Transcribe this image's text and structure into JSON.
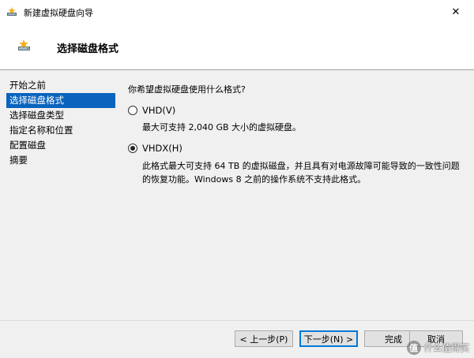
{
  "window": {
    "title": "新建虚拟硬盘向导",
    "close_glyph": "✕"
  },
  "header": {
    "title": "选择磁盘格式"
  },
  "sidebar": {
    "items": [
      {
        "label": "开始之前",
        "active": false
      },
      {
        "label": "选择磁盘格式",
        "active": true
      },
      {
        "label": "选择磁盘类型",
        "active": false
      },
      {
        "label": "指定名称和位置",
        "active": false
      },
      {
        "label": "配置磁盘",
        "active": false
      },
      {
        "label": "摘要",
        "active": false
      }
    ]
  },
  "main": {
    "question": "你希望虚拟硬盘使用什么格式?",
    "options": [
      {
        "label": "VHD(V)",
        "checked": false,
        "description": "最大可支持 2,040 GB 大小的虚拟硬盘。"
      },
      {
        "label": "VHDX(H)",
        "checked": true,
        "description": "此格式最大可支持 64 TB 的虚拟磁盘，并且具有对电源故障可能导致的一致性问题的恢复功能。Windows 8 之前的操作系统不支持此格式。"
      }
    ]
  },
  "footer": {
    "prev_label": "< 上一步(P)",
    "next_label": "下一步(N) >",
    "finish_label": "完成",
    "cancel_label": "取消"
  },
  "watermark": {
    "text": "什么值得买",
    "logo_text": "值"
  },
  "colors": {
    "active_selection": "#0a64bd",
    "body_background": "#f0f0f0",
    "primary_border": "#0078d7"
  }
}
